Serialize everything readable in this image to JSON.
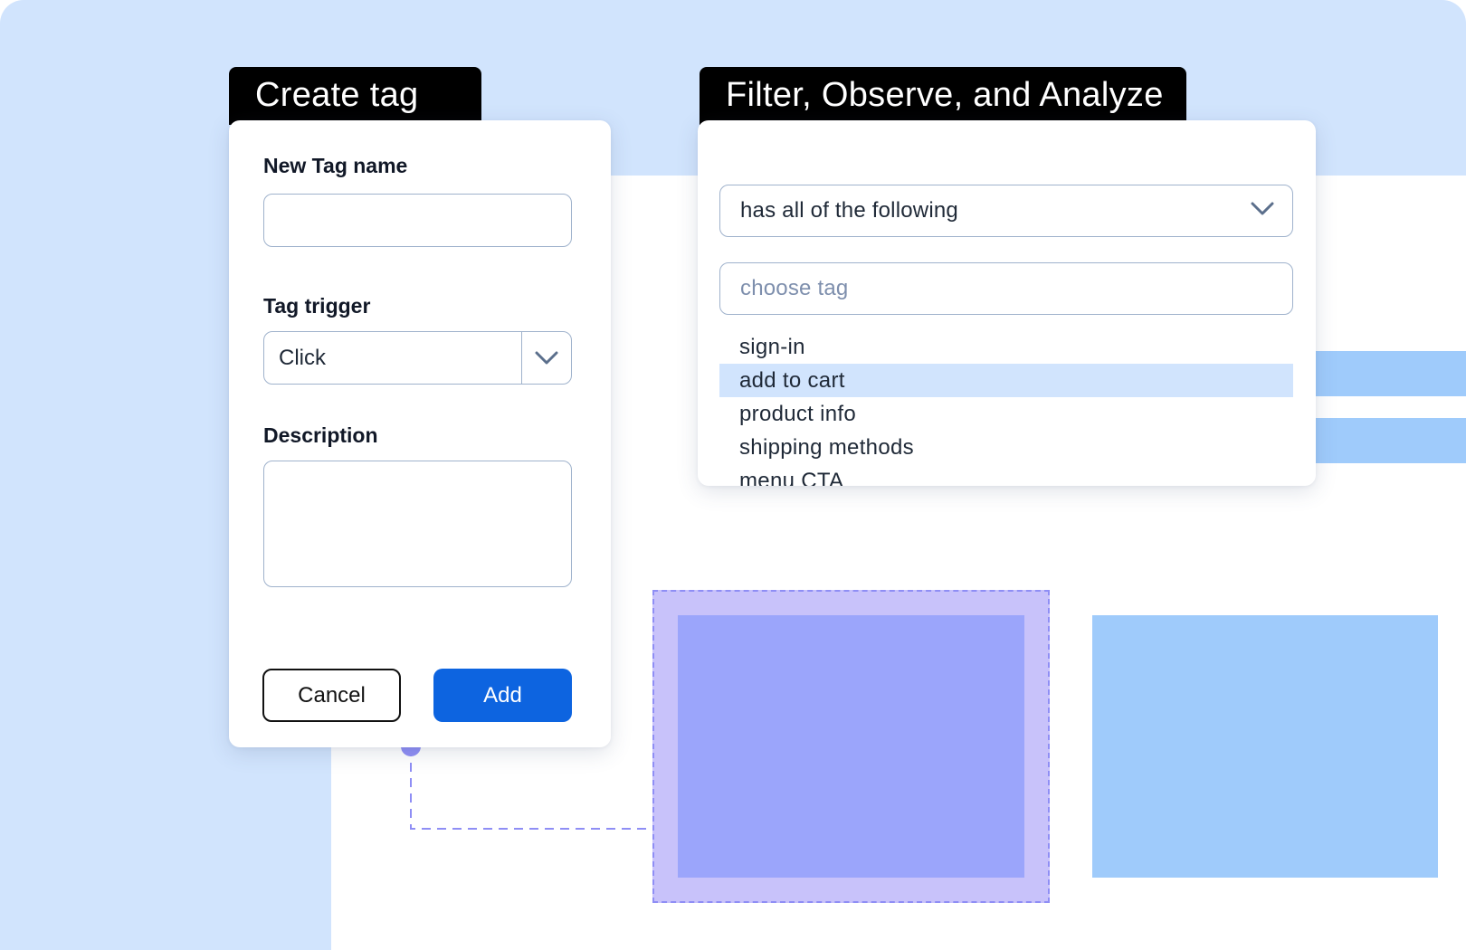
{
  "create_tag": {
    "tab_title": "Create tag",
    "name_label": "New Tag name",
    "name_value": "",
    "trigger_label": "Tag trigger",
    "trigger_value": "Click",
    "description_label": "Description",
    "description_value": "",
    "cancel_label": "Cancel",
    "add_label": "Add"
  },
  "filter": {
    "tab_title": "Filter, Observe, and Analyze",
    "condition_value": "has all of the following",
    "search_placeholder": "choose tag",
    "tags": [
      {
        "label": "sign-in",
        "selected": false
      },
      {
        "label": "add to cart",
        "selected": true
      },
      {
        "label": "product info",
        "selected": false
      },
      {
        "label": "shipping methods",
        "selected": false
      },
      {
        "label": "menu CTA",
        "selected": false
      }
    ]
  },
  "colors": {
    "background_blue": "#d1e4fd",
    "primary_button": "#0d64e0",
    "selected_row": "#d1e4fd",
    "highlight_frame": "#c8c2fa",
    "highlight_inner": "#9ba5fb",
    "block_blue": "#9fcbfb",
    "connector": "#8f8ef5"
  },
  "icons": {
    "trigger_dropdown": "chevron-down-icon",
    "condition_dropdown": "chevron-down-icon",
    "connector_node": "connector-dot-icon"
  }
}
